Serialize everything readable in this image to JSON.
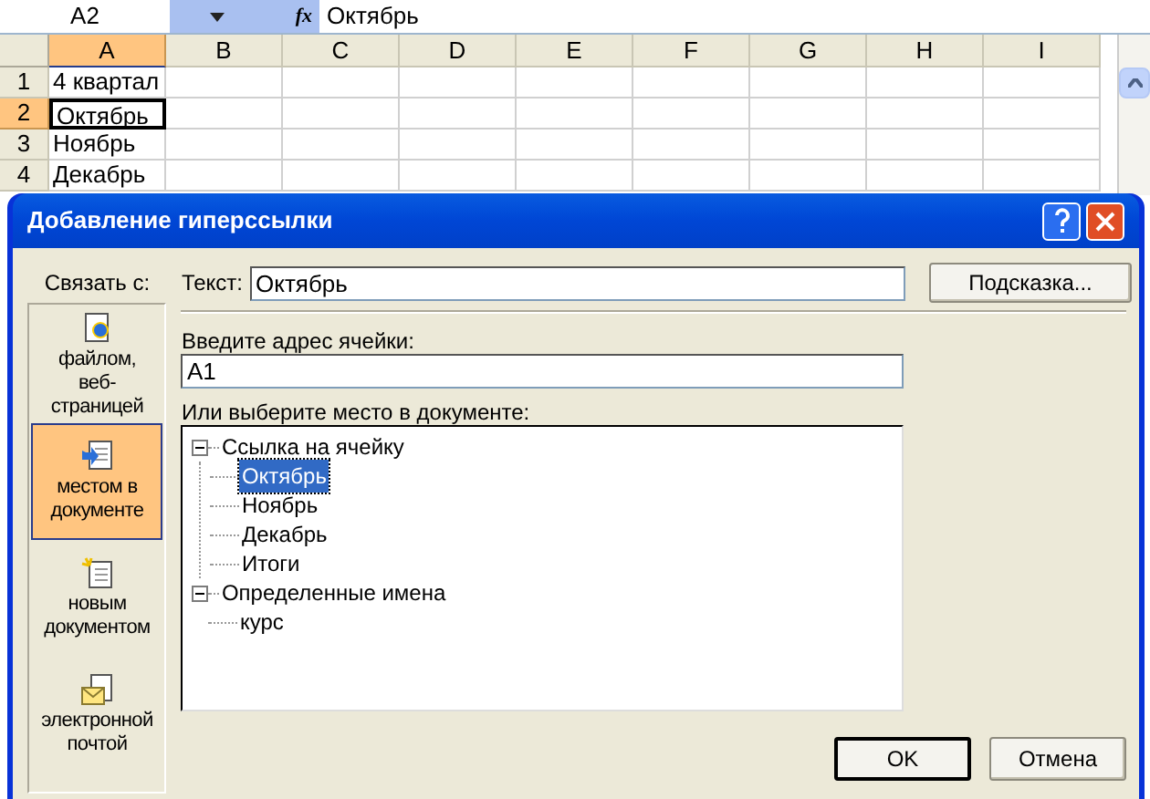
{
  "formula_bar": {
    "name_box": "A2",
    "fx": "fx",
    "value": "Октябрь"
  },
  "sheet": {
    "columns": [
      {
        "label": "A",
        "selected": true
      },
      {
        "label": "B",
        "selected": false
      },
      {
        "label": "C",
        "selected": false
      },
      {
        "label": "D",
        "selected": false
      },
      {
        "label": "E",
        "selected": false
      },
      {
        "label": "F",
        "selected": false
      },
      {
        "label": "G",
        "selected": false
      },
      {
        "label": "H",
        "selected": false
      },
      {
        "label": "I",
        "selected": false
      }
    ],
    "rows": [
      {
        "number": "1",
        "selected": false,
        "cell_a": "4 квартал"
      },
      {
        "number": "2",
        "selected": true,
        "cell_a": "Октябрь"
      },
      {
        "number": "3",
        "selected": false,
        "cell_a": "Ноябрь"
      },
      {
        "number": "4",
        "selected": false,
        "cell_a": "Декабрь"
      }
    ]
  },
  "dialog": {
    "title": "Добавление гиперссылки",
    "link_to_label": "Связать с:",
    "link_targets": [
      {
        "label": "файлом, веб-страницей",
        "kind": "file",
        "selected": false
      },
      {
        "label": "местом в документе",
        "kind": "place",
        "selected": true
      },
      {
        "label": "новым документом",
        "kind": "new",
        "selected": false
      },
      {
        "label": "электронной почтой",
        "kind": "mail",
        "selected": false
      }
    ],
    "text_label": "Текст:",
    "text_value": "Октябрь",
    "tip_button": "Подсказка...",
    "address_label": "Введите адрес ячейки:",
    "address_value": "A1",
    "place_label": "Или выберите место в документе:",
    "tree": [
      {
        "label": "Ссылка на ячейку",
        "expanded": true,
        "selected": false,
        "children": [
          {
            "label": "Октябрь",
            "selected": true
          },
          {
            "label": "Ноябрь",
            "selected": false
          },
          {
            "label": "Декабрь",
            "selected": false
          },
          {
            "label": "Итоги",
            "selected": false
          }
        ]
      },
      {
        "label": "Определенные имена",
        "expanded": true,
        "selected": false,
        "children": [
          {
            "label": "курс",
            "selected": false
          }
        ]
      }
    ],
    "buttons": [
      {
        "label": "OK",
        "default": true
      },
      {
        "label": "Отмена",
        "default": false
      }
    ]
  }
}
